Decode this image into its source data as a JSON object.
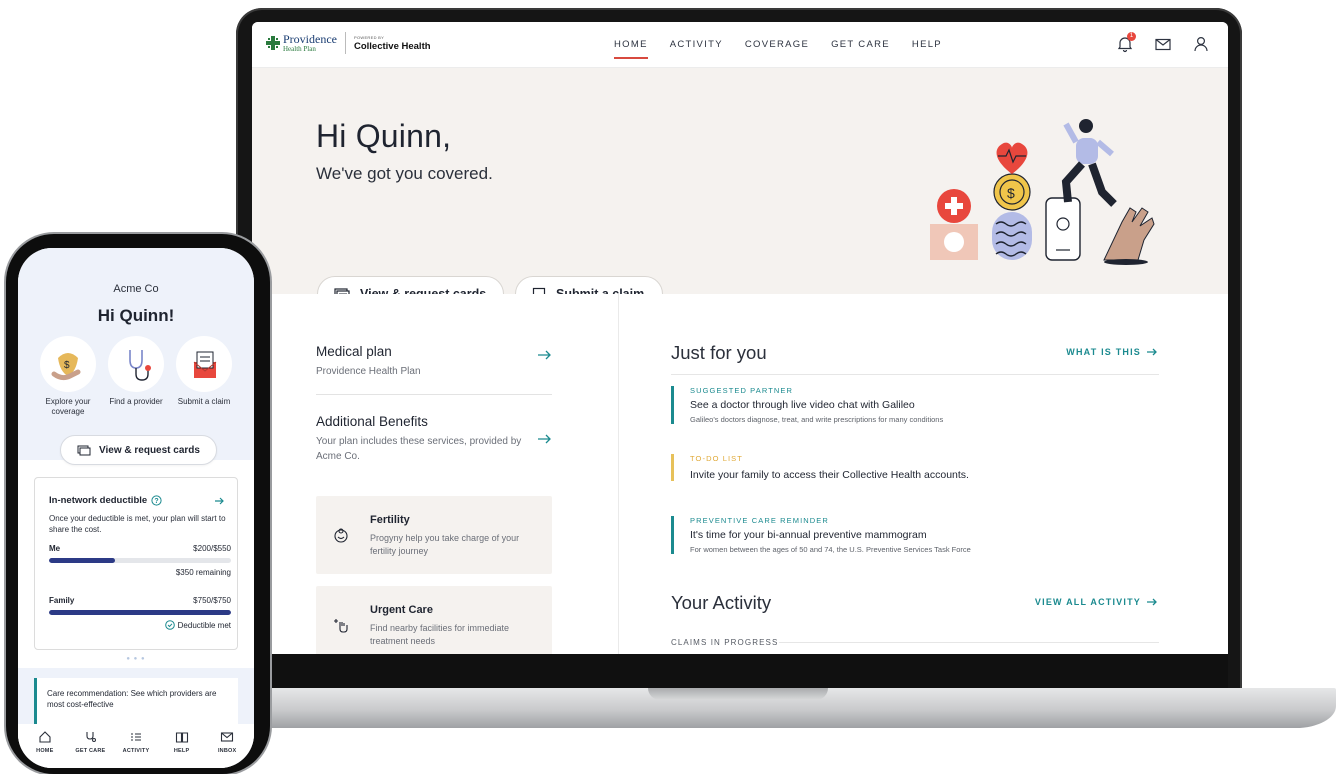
{
  "laptop": {
    "brand": {
      "provider_name": "Providence",
      "provider_sub": "Health Plan",
      "powered_by": "POWERED BY",
      "partner_name": "Collective Health"
    },
    "nav": {
      "links": [
        "HOME",
        "ACTIVITY",
        "COVERAGE",
        "GET CARE",
        "HELP"
      ],
      "active": "HOME",
      "notification_count": "1"
    },
    "hero": {
      "greeting": "Hi Quinn,",
      "subgreeting": "We've got you covered.",
      "cards_button": "View & request cards",
      "claim_button": "Submit a claim"
    },
    "plans": [
      {
        "title": "Medical plan",
        "desc": "Providence Health Plan"
      },
      {
        "title": "Additional Benefits",
        "desc": "Your plan includes these services, provided by Acme Co."
      }
    ],
    "benefits": [
      {
        "title": "Fertility",
        "desc": "Progyny help you take charge of your fertility journey",
        "icon": "fertility-icon"
      },
      {
        "title": "Urgent Care",
        "desc": "Find nearby facilities for immediate treatment needs",
        "icon": "urgent-care-icon"
      }
    ],
    "just_for_you": {
      "title": "Just for you",
      "link": "WHAT IS THIS",
      "items": [
        {
          "tag": "SUGGESTED PARTNER",
          "main": "See a doctor through live video chat with Galileo",
          "sub": "Galileo's doctors diagnose, treat, and write prescriptions for many conditions"
        },
        {
          "tag": "TO-DO LIST",
          "main": "Invite your family to access their Collective Health accounts.",
          "sub": ""
        },
        {
          "tag": "PREVENTIVE CARE REMINDER",
          "main": "It's time for your bi-annual preventive mammogram",
          "sub": "For women between the ages of 50 and 74, the U.S. Preventive Services Task Force"
        }
      ]
    },
    "activity": {
      "title": "Your Activity",
      "link": "VIEW ALL ACTIVITY",
      "claims_label": "CLAIMS IN PROGRESS"
    },
    "colors": {
      "accent": "#1b8a8f",
      "nav_active": "#d84a3f",
      "todo": "#e7c15a",
      "hero_bg": "#f5f2ef"
    }
  },
  "phone": {
    "company": "Acme Co",
    "greeting": "Hi Quinn!",
    "actions": [
      {
        "label": "Explore your coverage",
        "icon": "coverage-icon"
      },
      {
        "label": "Find a provider",
        "icon": "stethoscope-icon"
      },
      {
        "label": "Submit a claim",
        "icon": "envelope-claim-icon"
      }
    ],
    "cards_button": "View & request cards",
    "deductible": {
      "title": "In-network deductible",
      "desc": "Once your deductible is met, your plan will start to share the cost.",
      "rows": [
        {
          "label": "Me",
          "value": "$200/$550",
          "note": "$350 remaining",
          "fraction": 0.36
        },
        {
          "label": "Family",
          "value": "$750/$750",
          "note": "Deductible met",
          "fraction": 1.0
        }
      ]
    },
    "dots": "● ● ●",
    "recommendation": "Care recommendation: See which providers are most cost-effective",
    "tabs": [
      "HOME",
      "GET CARE",
      "ACTIVITY",
      "HELP",
      "INBOX"
    ]
  }
}
